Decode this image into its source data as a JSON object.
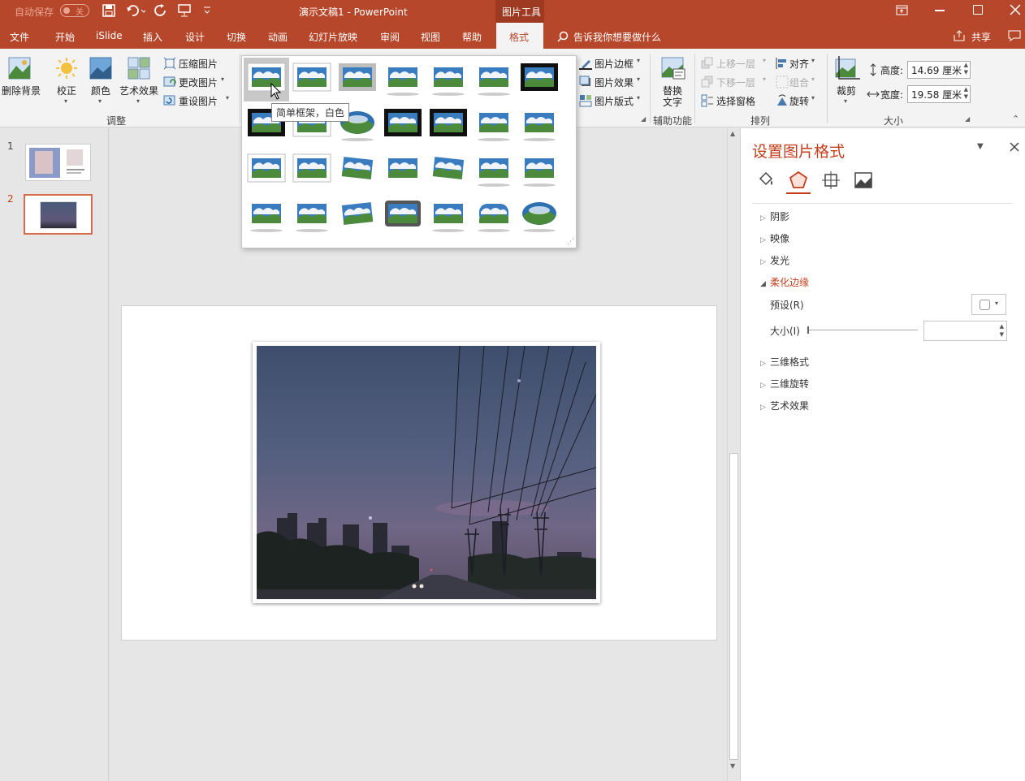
{
  "titlebar": {
    "autosave_label": "自动保存",
    "autosave_state": "关",
    "doc_title": "演示文稿1  -  PowerPoint",
    "tools_label": "图片工具"
  },
  "tabs": [
    "文件",
    "开始",
    "iSlide",
    "插入",
    "设计",
    "切换",
    "动画",
    "幻灯片放映",
    "审阅",
    "视图",
    "帮助",
    "格式"
  ],
  "tell_me": "告诉我你想要做什么",
  "share": "共享",
  "ribbon": {
    "remove_bg": "删除背景",
    "correct": "校正",
    "color": "颜色",
    "art_effects": "艺术效果",
    "compress": "压缩图片",
    "change": "更改图片",
    "reset": "重设图片",
    "group_adjust": "调整",
    "border": "图片边框",
    "effects": "图片效果",
    "layout": "图片版式",
    "alt_text_1": "替换",
    "alt_text_2": "文字",
    "group_assist": "辅助功能",
    "bring_forward": "上移一层",
    "send_backward": "下移一层",
    "selection_pane": "选择窗格",
    "align": "对齐",
    "group_obj": "组合",
    "rotate": "旋转",
    "group_arrange": "排列",
    "crop": "裁剪",
    "height_label": "高度:",
    "height_value": "14.69 厘米",
    "width_label": "宽度:",
    "width_value": "19.58 厘米",
    "group_size": "大小"
  },
  "gallery_tooltip": "简单框架，白色",
  "slides": [
    "1",
    "2"
  ],
  "pane": {
    "title": "设置图片格式",
    "sections": [
      "阴影",
      "映像",
      "发光",
      "柔化边缘",
      "三维格式",
      "三维旋转",
      "艺术效果"
    ],
    "preset_label": "预设(R)",
    "size_label": "大小(I)"
  },
  "colors": {
    "brand": "#b7472a",
    "accent_text": "#c43e1c"
  }
}
